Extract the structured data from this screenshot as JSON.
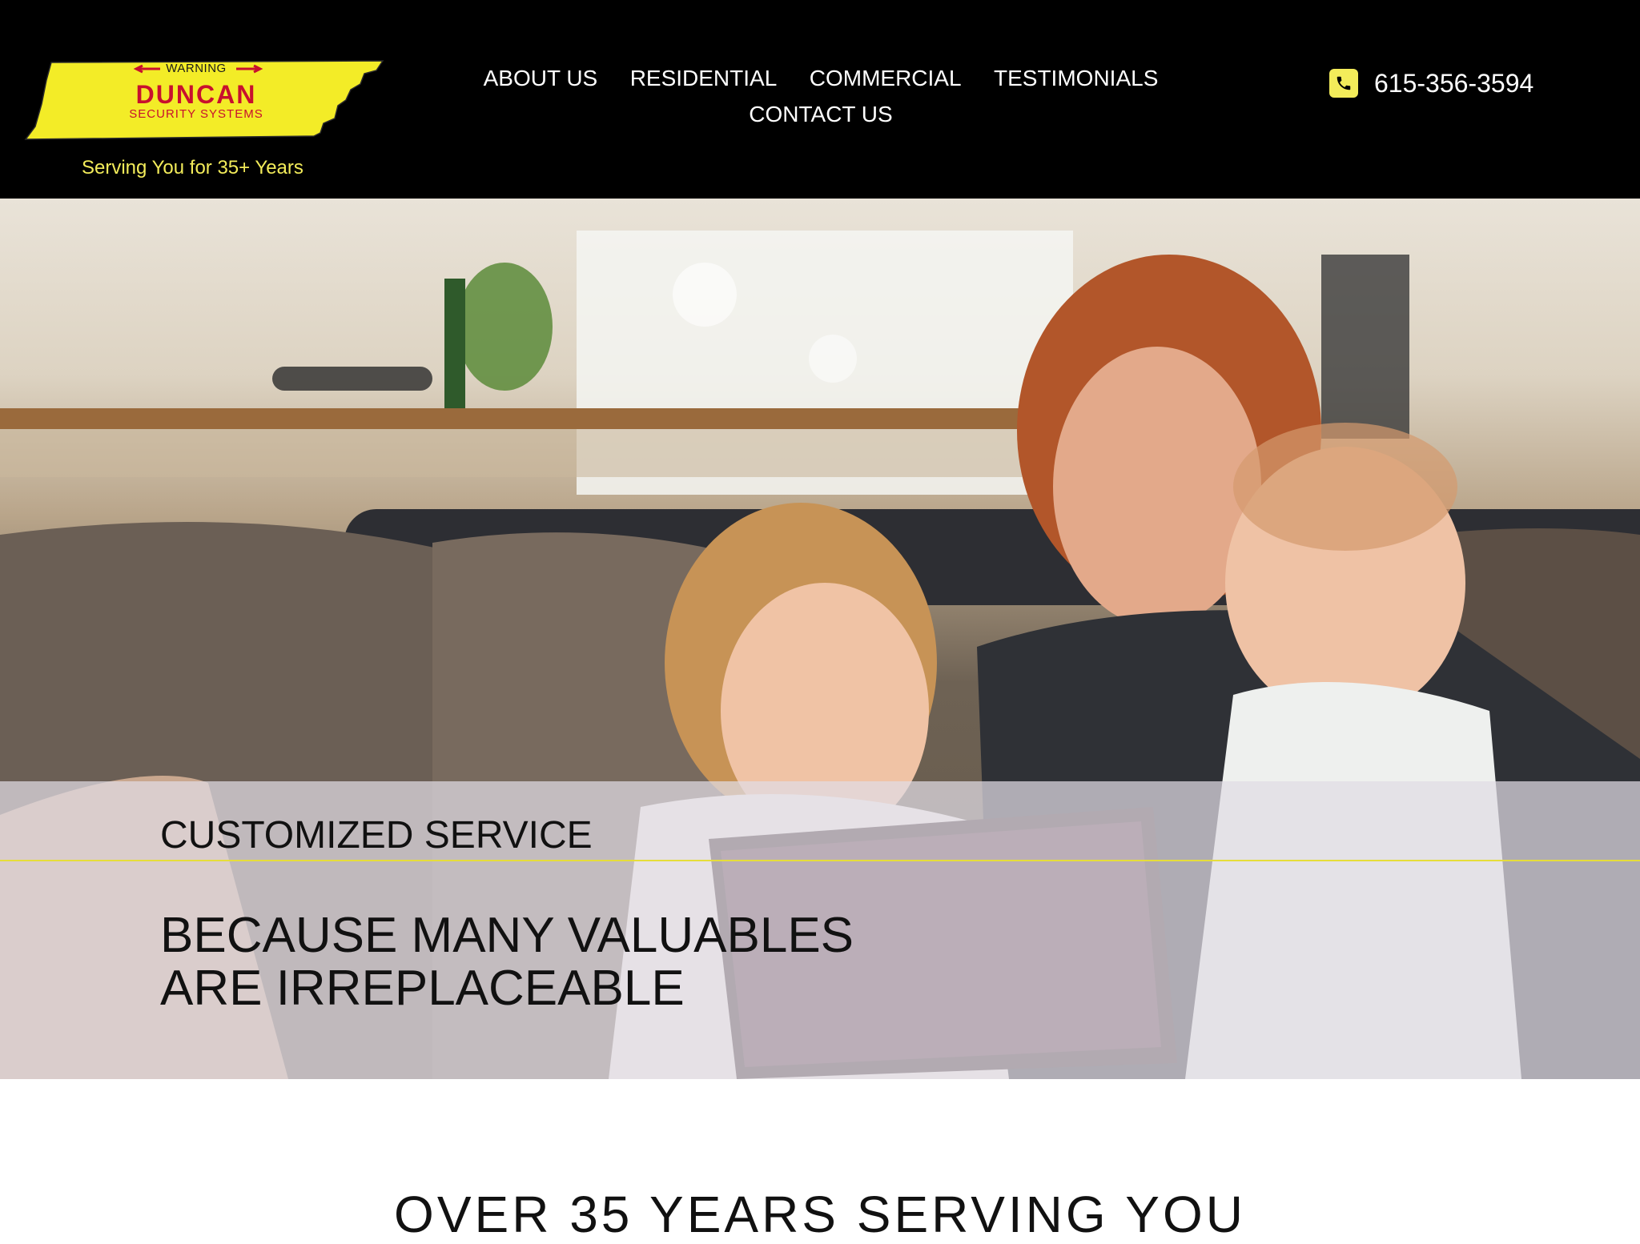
{
  "header": {
    "logo": {
      "warning": "WARNING",
      "name": "DUNCAN",
      "subtitle": "SECURITY SYSTEMS"
    },
    "tagline": "Serving You for 35+ Years",
    "nav": [
      {
        "label": "ABOUT US"
      },
      {
        "label": "RESIDENTIAL"
      },
      {
        "label": "COMMERCIAL"
      },
      {
        "label": "TESTIMONIALS"
      },
      {
        "label": "CONTACT US"
      }
    ],
    "phone": "615-356-3594"
  },
  "hero": {
    "eyebrow": "CUSTOMIZED SERVICE",
    "headline": "BECAUSE MANY VALUABLES ARE IRREPLACEABLE"
  },
  "section": {
    "title": "OVER 35 YEARS SERVING YOU"
  },
  "colors": {
    "header_bg": "#000000",
    "accent_yellow": "#f3ec5a",
    "logo_red": "#c8102e",
    "text_dark": "#111111"
  },
  "icons": {
    "phone": "phone-icon"
  }
}
